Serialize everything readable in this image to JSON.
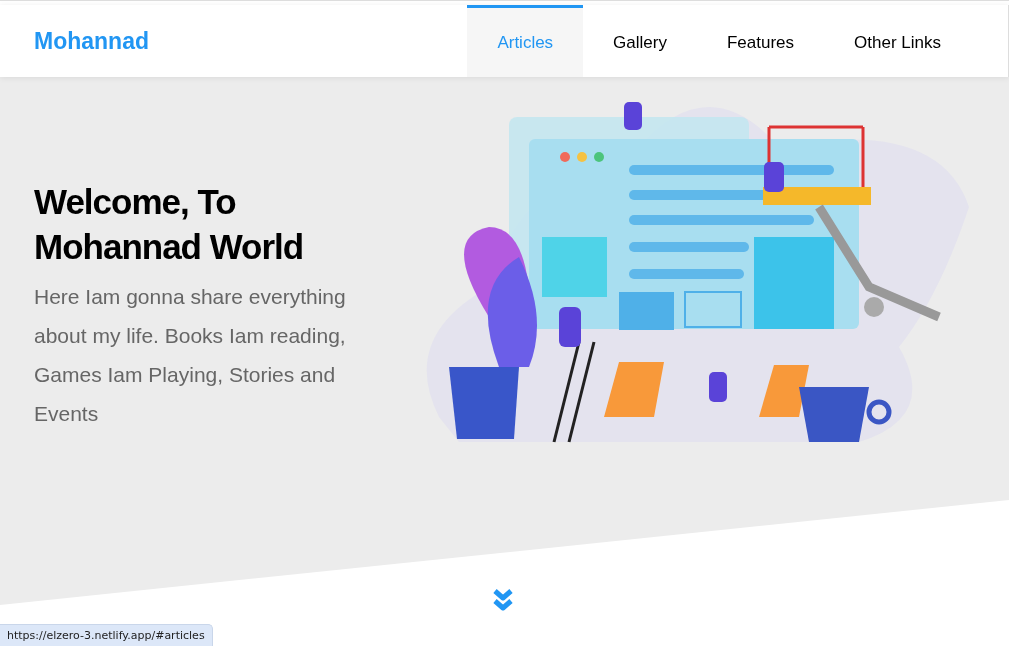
{
  "header": {
    "brand": "Mohannad",
    "nav": [
      {
        "label": "Articles",
        "selected": true
      },
      {
        "label": "Gallery",
        "selected": false
      },
      {
        "label": "Features",
        "selected": false
      },
      {
        "label": "Other Links",
        "selected": false
      }
    ]
  },
  "hero": {
    "title": "Welcome, To Mohannad World",
    "text": "Here Iam gonna share everything about my life. Books Iam reading, Games Iam Playing, Stories and Events"
  },
  "status_bar": {
    "url": "https://elzero-3.netlify.app/#articles"
  }
}
